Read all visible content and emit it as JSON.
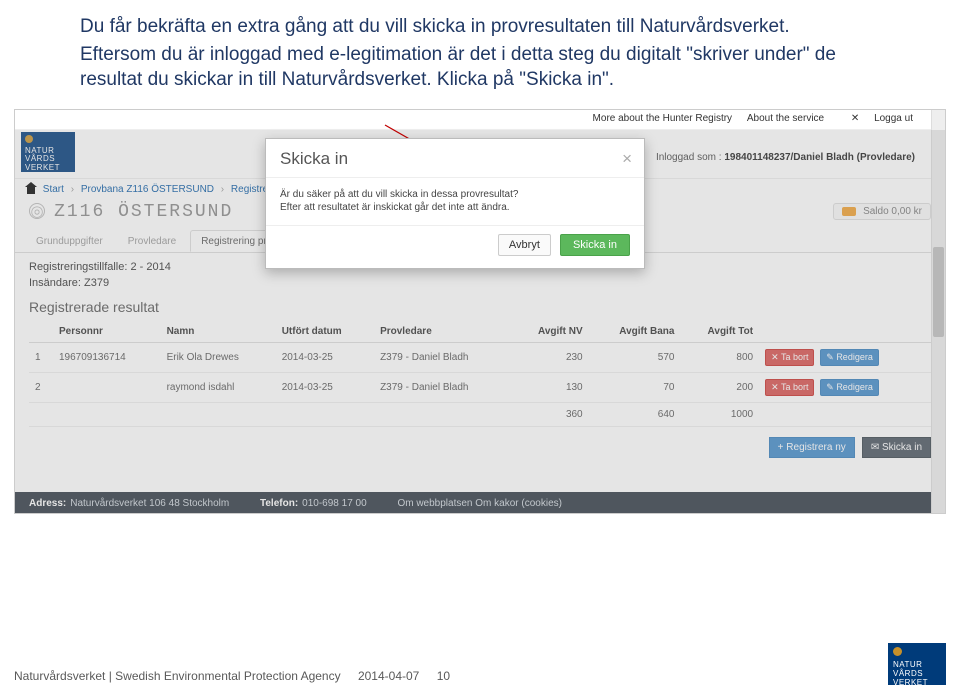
{
  "slide": {
    "p1": "Du får bekräfta en extra gång att du vill skicka in provresultaten till Naturvårdsverket.",
    "p2": "Eftersom du är inloggad med e-legitimation är det i detta steg du digitalt \"skriver under\" de resultat du skickar in till Naturvårdsverket. Klicka på \"Skicka in\"."
  },
  "topnav": {
    "more": "More about the Hunter Registry",
    "about": "About the service",
    "logout": "Logga ut",
    "logout_icon": "✕"
  },
  "logo_text": "NATUR\nVÅRDS\nVERKET",
  "logged_in_label": "Inloggad som",
  "logged_in_value": "198401148237/Daniel Bladh (Provledare)",
  "breadcrumb": {
    "start": "Start",
    "item2": "Provbana Z116 ÖSTERSUND",
    "item3": "Registreringstillfä…"
  },
  "modal": {
    "title": "Skicka in",
    "body1": "Är du säker på att du vill skicka in dessa provresultat?",
    "body2": "Efter att resultatet är inskickat går det inte att ändra.",
    "cancel": "Avbryt",
    "submit": "Skicka in"
  },
  "page_title": "Z116 ÖSTERSUND",
  "saldo_label": "Saldo",
  "saldo_value": "0,00 kr",
  "tabs": {
    "t1": "Grunduppgifter",
    "t2": "Provledare",
    "t3": "Registrering provresultat"
  },
  "reg_line": "Registreringstillfalle: 2 - 2014",
  "insandare": "Insändare: Z379",
  "results_heading": "Registrerade resultat",
  "cols": {
    "nr": "",
    "personnr": "Personnr",
    "namn": "Namn",
    "utfort": "Utfört datum",
    "provledare": "Provledare",
    "avnv": "Avgift NV",
    "avbana": "Avgift Bana",
    "avtot": "Avgift Tot"
  },
  "rows": [
    {
      "idx": "1",
      "pnr": "196709136714",
      "namn": "Erik Ola Drewes",
      "datum": "2014-03-25",
      "prov": "Z379 - Daniel Bladh",
      "nv": "230",
      "bana": "570",
      "tot": "800"
    },
    {
      "idx": "2",
      "pnr": "",
      "namn": "raymond isdahl",
      "datum": "2014-03-25",
      "prov": "Z379 - Daniel Bladh",
      "nv": "130",
      "bana": "70",
      "tot": "200"
    }
  ],
  "totals": {
    "nv": "360",
    "bana": "640",
    "tot": "1000"
  },
  "row_actions": {
    "delete": "Ta bort",
    "edit": "Redigera"
  },
  "bottom_actions": {
    "new": "Registrera ny",
    "send": "Skicka in"
  },
  "ss_footer": {
    "adress_label": "Adress:",
    "adress": "Naturvårdsverket 106 48 Stockholm",
    "tel_label": "Telefon:",
    "tel": "010-698 17 00",
    "links": "Om webbplatsen    Om kakor (cookies)"
  },
  "footer": {
    "org": "Naturvårdsverket | Swedish Environmental Protection Agency",
    "date": "2014-04-07",
    "page": "10"
  }
}
